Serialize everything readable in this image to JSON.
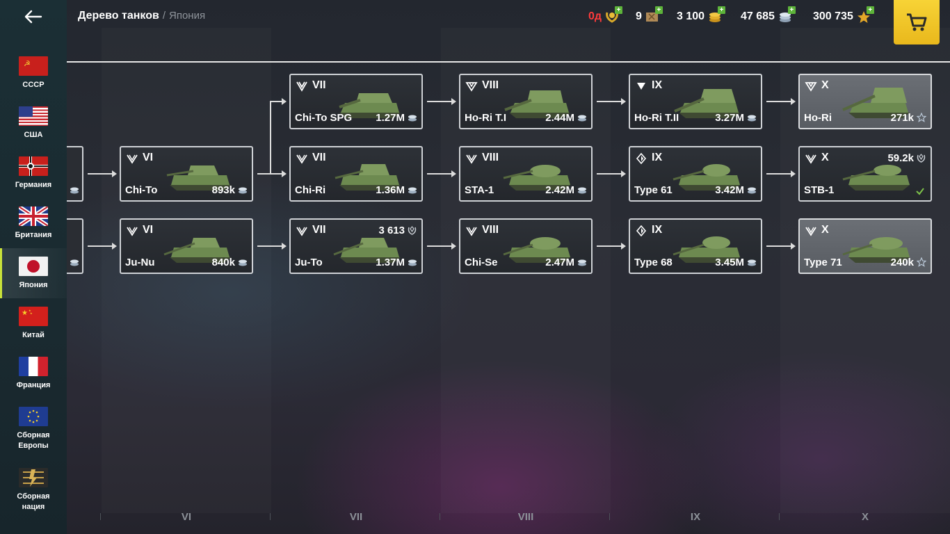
{
  "header": {
    "title": "Дерево танков",
    "separator": "/",
    "subtitle": "Япония"
  },
  "currencies": {
    "premium_days": "0д",
    "boosters": "9",
    "gold": "3 100",
    "credits": "47 685",
    "free_xp": "300 735"
  },
  "sidebar": {
    "nations": [
      {
        "label": "СССР",
        "flag": "ussr"
      },
      {
        "label": "США",
        "flag": "usa"
      },
      {
        "label": "Германия",
        "flag": "germany"
      },
      {
        "label": "Британия",
        "flag": "uk"
      },
      {
        "label": "Япония",
        "flag": "japan",
        "active": true
      },
      {
        "label": "Китай",
        "flag": "china"
      },
      {
        "label": "Франция",
        "flag": "france"
      },
      {
        "label": "Сборная Европы",
        "flag": "eu"
      },
      {
        "label": "Сборная нация",
        "flag": "mercenary"
      }
    ]
  },
  "tree": {
    "row1": [
      {
        "tier": "VII",
        "name": "Chi-To SPG",
        "price": "1.27M",
        "class": "heavy-elite"
      },
      {
        "tier": "VIII",
        "name": "Ho-Ri T.I",
        "price": "2.44M",
        "class": "td-elite"
      },
      {
        "tier": "IX",
        "name": "Ho-Ri T.II",
        "price": "3.27M",
        "class": "td"
      },
      {
        "tier": "X",
        "name": "Ho-Ri",
        "price": "271k",
        "class": "td-elite"
      }
    ],
    "row2": [
      {
        "tier": "VI",
        "name": "Chi-To",
        "price": "893k",
        "class": "medium"
      },
      {
        "tier": "VII",
        "name": "Chi-Ri",
        "price": "1.36M",
        "class": "medium"
      },
      {
        "tier": "VIII",
        "name": "STA-1",
        "price": "2.42M",
        "class": "medium"
      },
      {
        "tier": "IX",
        "name": "Type 61",
        "price": "3.42M",
        "class": "light"
      },
      {
        "tier": "X",
        "name": "STB-1",
        "xp": "59.2k",
        "class": "medium"
      }
    ],
    "row3": [
      {
        "tier": "VI",
        "name": "Ju-Nu",
        "price": "840k",
        "class": "medium"
      },
      {
        "tier": "VII",
        "name": "Ju-To",
        "price": "1.37M",
        "xp": "3 613",
        "class": "medium"
      },
      {
        "tier": "VIII",
        "name": "Chi-Se",
        "price": "2.47M",
        "class": "medium"
      },
      {
        "tier": "IX",
        "name": "Type 68",
        "price": "3.45M",
        "class": "light"
      },
      {
        "tier": "X",
        "name": "Type 71",
        "price": "240k",
        "class": "medium"
      }
    ]
  },
  "tiers": [
    "VI",
    "VII",
    "VIII",
    "IX",
    "X"
  ],
  "colors": {
    "accent": "#c9e23a",
    "shop": "#f2c62b",
    "plus": "#5db43a",
    "premium_red": "#ff3b3b",
    "check": "#7ec34a"
  },
  "icons": {
    "back": "arrow-left-icon",
    "shop": "cart-icon",
    "credits": "silver-coin-icon",
    "xp": "wreath-icon",
    "free_xp": "star-icon"
  }
}
